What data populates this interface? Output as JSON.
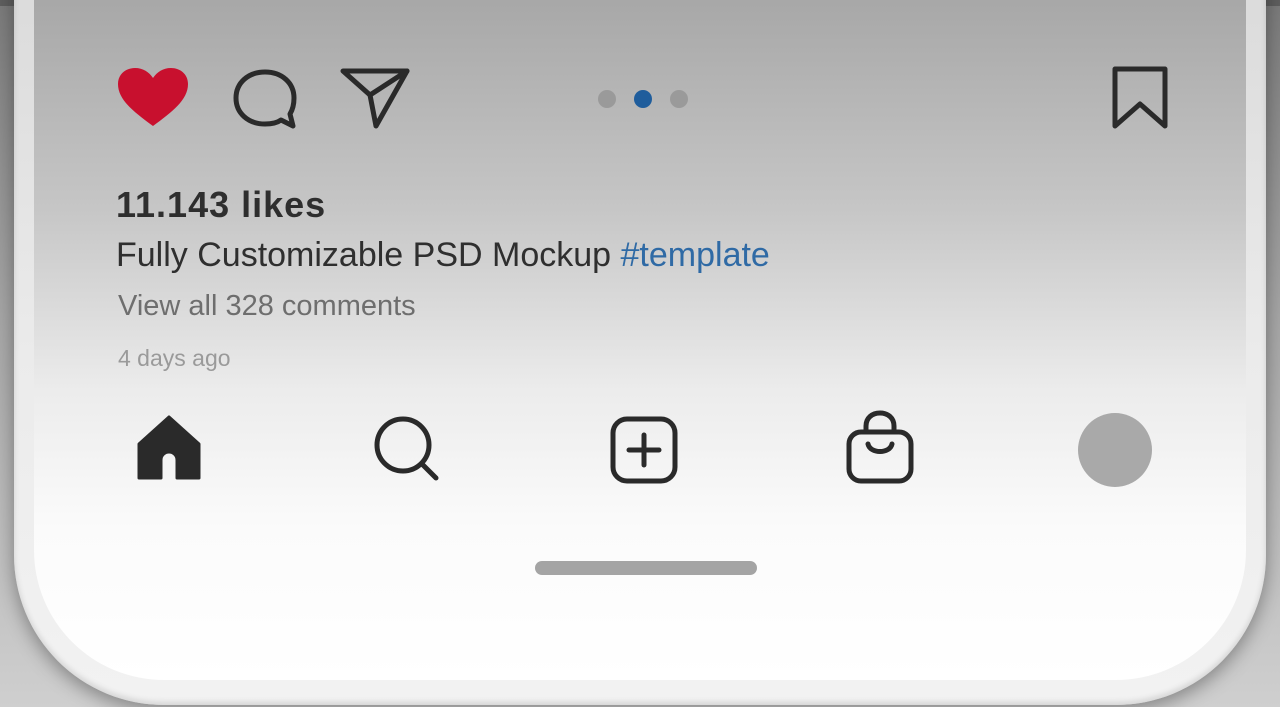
{
  "post": {
    "likes_text": "11.143 likes",
    "caption_text": "Fully Customizable PSD Mockup",
    "caption_hashtag": "#template",
    "view_comments_text": "View all 328 comments",
    "timestamp_text": "4 days ago",
    "liked": true,
    "carousel": {
      "total": 3,
      "active_index": 1
    }
  },
  "actions": {
    "like_icon": "heart-icon",
    "comment_icon": "comment-bubble-icon",
    "share_icon": "paper-plane-icon",
    "save_icon": "bookmark-icon"
  },
  "bottom_nav": {
    "items": [
      "home-icon",
      "search-icon",
      "add-post-icon",
      "shopping-bag-icon",
      "profile-avatar"
    ]
  },
  "colors": {
    "like_red": "#c8102e",
    "hashtag_blue": "#2f6aa5",
    "active_dot": "#1f5d9c",
    "icon_dark": "#2a2a2a"
  }
}
